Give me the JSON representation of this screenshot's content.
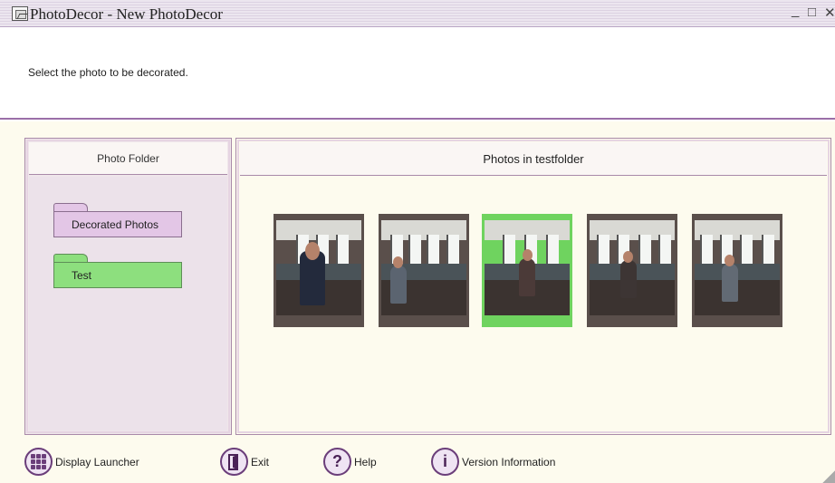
{
  "window": {
    "title": "PhotoDecor - New PhotoDecor",
    "minimize_label": "_",
    "maximize_label": "□",
    "close_label": "✕"
  },
  "instruction": "Select the photo to be decorated.",
  "photo_folder_panel": {
    "header": "Photo Folder",
    "folders": [
      {
        "label": "Decorated Photos",
        "selected": false,
        "color": "#e3c6e6"
      },
      {
        "label": "Test",
        "selected": true,
        "color": "#8ddf7e"
      }
    ]
  },
  "photos_panel": {
    "header": "Photos in testfolder",
    "selected_index": 2,
    "photo_count": 5
  },
  "footer": {
    "items": [
      {
        "label": "Display Launcher",
        "icon": "grid-icon"
      },
      {
        "label": "Exit",
        "icon": "exit-door-icon"
      },
      {
        "label": "Help",
        "icon": "help-question-icon"
      },
      {
        "label": "Version Information",
        "icon": "info-icon"
      }
    ]
  },
  "colors": {
    "accent_purple": "#6b3e7a",
    "selected_green": "#6fd35f",
    "content_bg": "#fdfbee"
  }
}
